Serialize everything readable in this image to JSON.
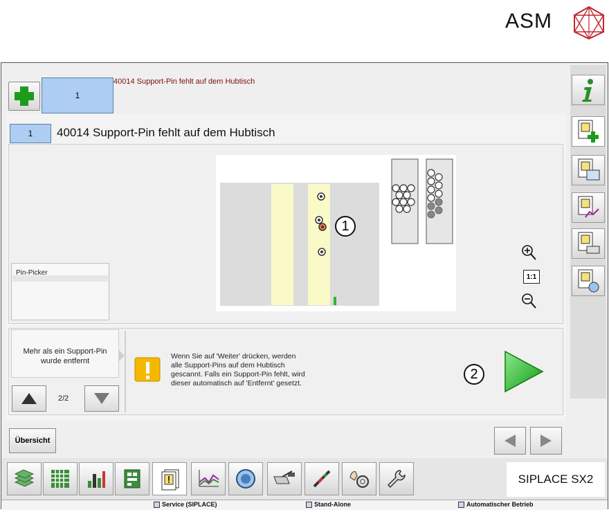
{
  "brand": {
    "name": "ASM",
    "color": "#c0262e"
  },
  "top": {
    "add_icon": "green-plus-icon",
    "tab_label": "1",
    "message": "40014 Support-Pin fehlt auf dem Hubtisch"
  },
  "header": {
    "number": "1",
    "title": "40014 Support-Pin fehlt auf dem Hubtisch"
  },
  "pin_picker": {
    "label": "Pin-Picker"
  },
  "diagram": {
    "callout_1": "1",
    "callout_2": "2",
    "zoom_in_icon": "zoom-in-icon",
    "zoom_fit": "1:1",
    "zoom_out_icon": "zoom-out-icon"
  },
  "hint": {
    "line1": "Mehr als ein Support-Pin",
    "line2": "wurde entfernt",
    "page": "2/2"
  },
  "message": {
    "lines": [
      "Wenn Sie auf 'Weiter' drücken, werden",
      "alle Support-Pins auf dem Hubtisch",
      "gescannt. Falls ein Support-Pin fehlt, wird",
      "dieser automatisch auf 'Entfernt' gesetzt."
    ]
  },
  "overview_button": "Übersicht",
  "sidebar": [
    "info-icon",
    "alarm-add-icon",
    "alarm-monitor-icon",
    "alarm-chart-icon",
    "alarm-print-icon",
    "alarm-camera-icon"
  ],
  "taskbar": {
    "buttons": [
      "stack-icon",
      "grid-icon",
      "bar-chart-icon",
      "board-icon",
      "alarm-icon",
      "trend-icon",
      "camera-icon",
      "feeder-icon",
      "nozzle-icon",
      "hand-gear-icon",
      "wrench-icon"
    ],
    "machine": "SIPLACE SX2"
  },
  "status": {
    "user": "Service (SIPLACE)",
    "mode": "Stand-Alone",
    "operation": "Automatischer Betrieb"
  },
  "colors": {
    "accent_blue": "#aecdf2",
    "ok_green": "#2bb52b",
    "warning_yellow": "#f5b800",
    "pin_strip": "#fafac8"
  }
}
